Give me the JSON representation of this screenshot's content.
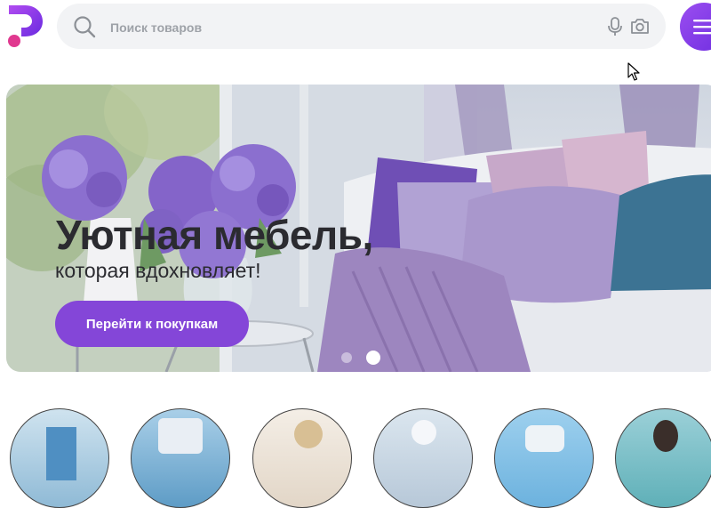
{
  "header": {
    "search": {
      "placeholder": "Поиск товаров",
      "value": ""
    },
    "icons": {
      "logo": "brand-logo-p",
      "search": "search-icon",
      "mic": "microphone-icon",
      "camera": "camera-icon",
      "menu": "hamburger-menu-icon"
    }
  },
  "hero": {
    "title": "Уютная мебель,",
    "subtitle": "которая вдохновляет!",
    "cta_label": "Перейти к покупкам",
    "slide_count": 2,
    "active_slide": 2
  },
  "categories": [
    {
      "image": "category-thumb-1"
    },
    {
      "image": "category-thumb-2"
    },
    {
      "image": "category-thumb-3"
    },
    {
      "image": "category-thumb-4"
    },
    {
      "image": "category-thumb-5"
    },
    {
      "image": "category-thumb-6"
    }
  ],
  "colors": {
    "accent": "#8446d8",
    "search_bg": "#f2f3f5",
    "menu_gradient_start": "#9b4ef0",
    "menu_gradient_end": "#6f2ee0"
  }
}
